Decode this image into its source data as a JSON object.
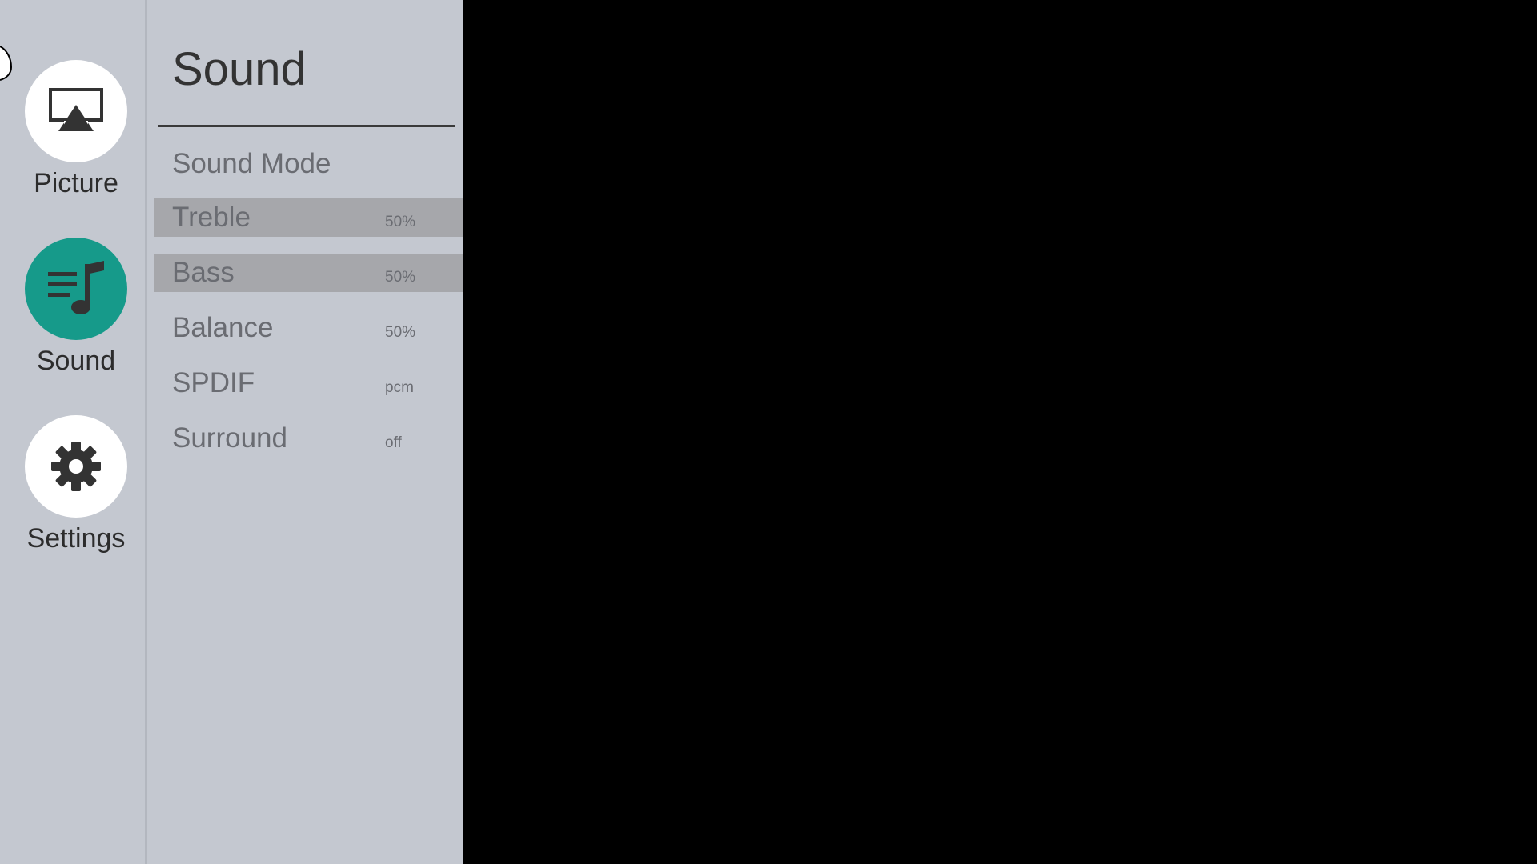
{
  "rail": {
    "items": [
      {
        "label": "Picture",
        "icon": "airplay-screen-icon",
        "active": false
      },
      {
        "label": "Sound",
        "icon": "music-note-icon",
        "active": true
      },
      {
        "label": "Settings",
        "icon": "gear-icon",
        "active": false
      }
    ]
  },
  "panel": {
    "title": "Sound",
    "items": [
      {
        "label": "Sound Mode",
        "value": ""
      },
      {
        "label": "Treble",
        "value": "50%"
      },
      {
        "label": "Bass",
        "value": "50%"
      },
      {
        "label": "Balance",
        "value": "50%"
      },
      {
        "label": "SPDIF",
        "value": "pcm"
      },
      {
        "label": "Surround",
        "value": "off"
      }
    ]
  },
  "colors": {
    "accent": "#169a8a",
    "panel_bg": "#c4c8d0",
    "highlight_bg": "#a6a7ab",
    "screen_bg": "#000000"
  }
}
